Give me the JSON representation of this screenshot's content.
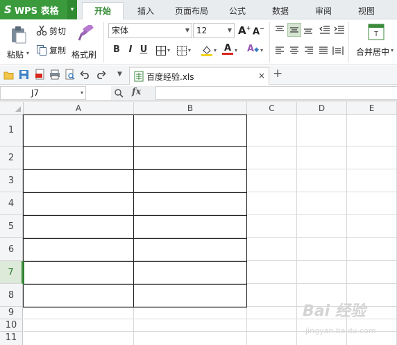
{
  "app": {
    "logo": "WPS 表格"
  },
  "menu": [
    "开始",
    "插入",
    "页面布局",
    "公式",
    "数据",
    "审阅",
    "视图"
  ],
  "ribbon": {
    "paste": "粘贴",
    "cut": "剪切",
    "copy": "复制",
    "format_painter": "格式刷",
    "font_name": "宋体",
    "font_size": "12",
    "merge_center": "合并居中"
  },
  "document": {
    "tab_name": "百度经验.xls"
  },
  "formula_bar": {
    "name_box": "J7",
    "fx_label": "fx",
    "value": ""
  },
  "sheet": {
    "columns": [
      "A",
      "B",
      "C",
      "D",
      "E"
    ],
    "rows": [
      "1",
      "2",
      "3",
      "4",
      "5",
      "6",
      "7",
      "8",
      "9",
      "10",
      "11"
    ],
    "selected_row": "7",
    "selected_cell": "A7"
  },
  "watermark": {
    "text": "Bai 经验",
    "sub": "jingyan.baidu.com"
  },
  "colors": {
    "brand_green": "#3a9a3c",
    "selection": "#2f7f2f",
    "grid": "#d9d9d9"
  }
}
